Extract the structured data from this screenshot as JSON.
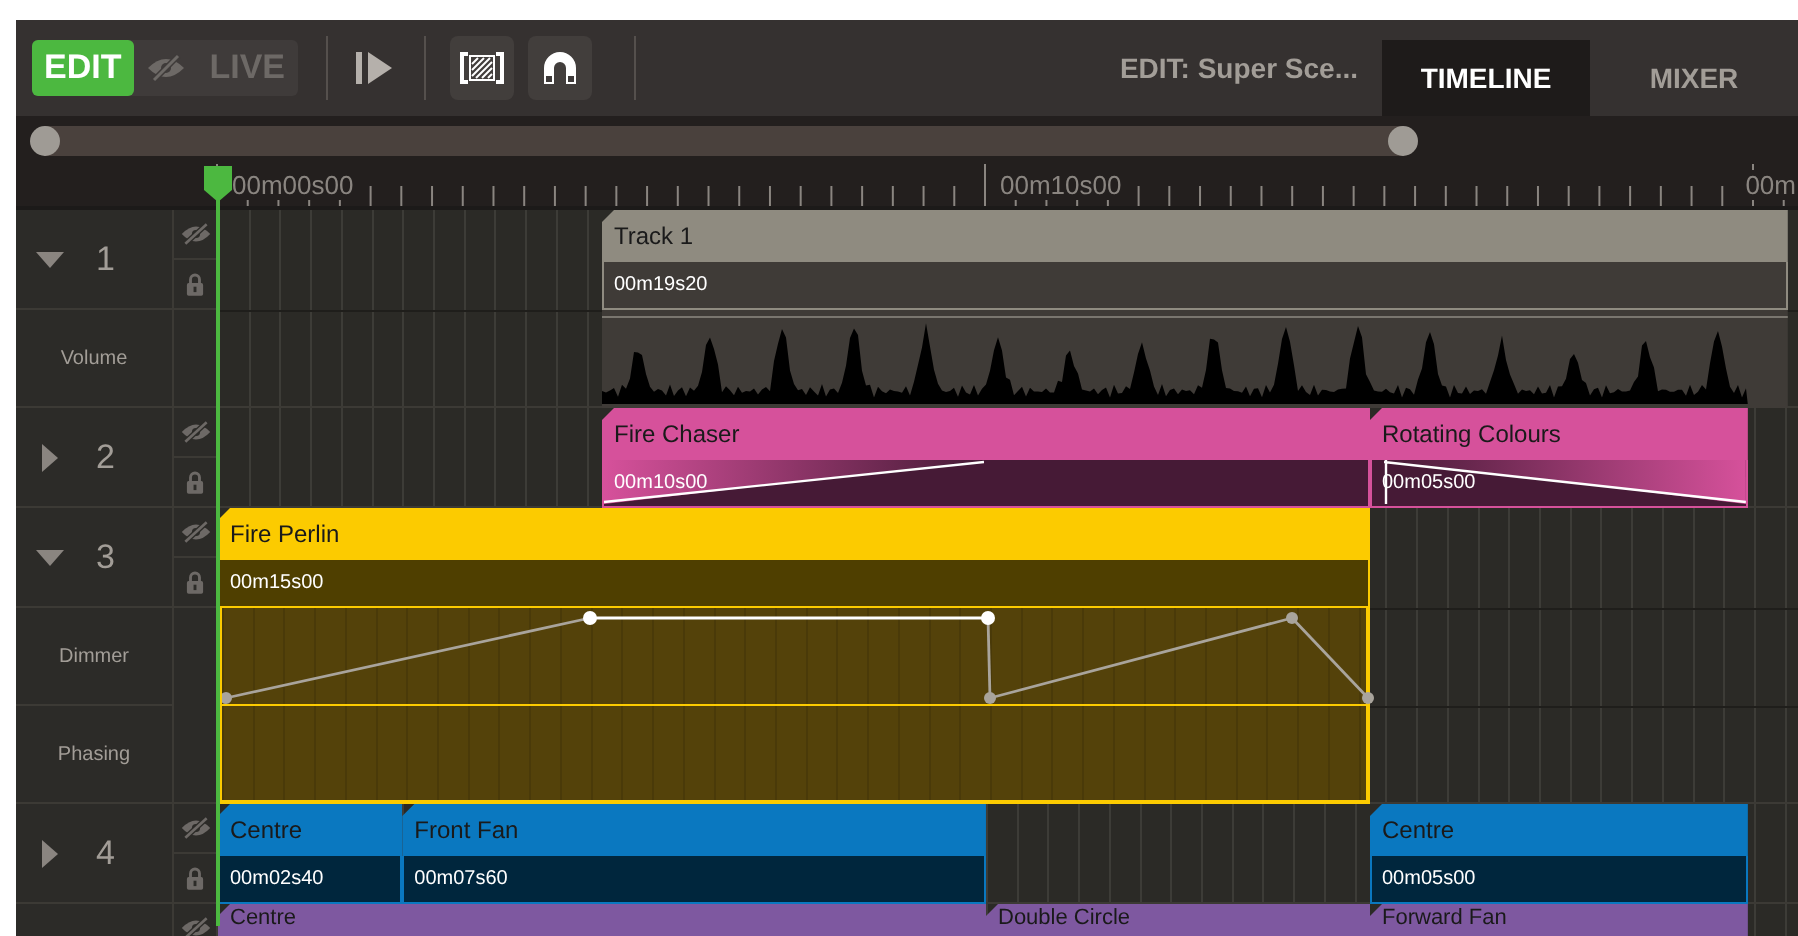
{
  "toolbar": {
    "mode_buttons": [
      {
        "label": "EDIT",
        "selected": true
      },
      {
        "label": "LIVE",
        "selected": false
      }
    ],
    "edit_title": "EDIT: Super Sce...",
    "tabs": [
      {
        "label": "TIMELINE",
        "selected": true
      },
      {
        "label": "MIXER",
        "selected": false
      }
    ]
  },
  "ruler": {
    "labels": [
      "00m00s00",
      "00m10s00",
      "00m"
    ]
  },
  "tracks": [
    {
      "number": "1",
      "expanded": true,
      "color": "#8f8b80",
      "clips": [
        {
          "name": "Track 1",
          "duration": "00m19s20"
        }
      ],
      "lanes": [
        {
          "label": "Volume",
          "kind": "waveform"
        }
      ]
    },
    {
      "number": "2",
      "expanded": false,
      "color": "#d6519b",
      "clips": [
        {
          "name": "Fire Chaser",
          "duration": "00m10s00"
        },
        {
          "name": "Rotating Colours",
          "duration": "00m05s00"
        }
      ]
    },
    {
      "number": "3",
      "expanded": true,
      "color": "#fccb00",
      "clips": [
        {
          "name": "Fire Perlin",
          "duration": "00m15s00"
        }
      ],
      "lanes": [
        {
          "label": "Dimmer",
          "kind": "automation"
        },
        {
          "label": "Phasing",
          "kind": "automation"
        }
      ]
    },
    {
      "number": "4",
      "expanded": false,
      "color": "#0a78c0",
      "clips": [
        {
          "name": "Centre",
          "duration": "00m02s40"
        },
        {
          "name": "Front Fan",
          "duration": "00m07s60"
        },
        {
          "name": "Centre",
          "duration": "00m05s00"
        }
      ]
    },
    {
      "color": "#7e58a0",
      "clips": [
        {
          "name": "Centre"
        },
        {
          "name": "Double Circle"
        },
        {
          "name": "Forward Fan"
        }
      ]
    }
  ]
}
